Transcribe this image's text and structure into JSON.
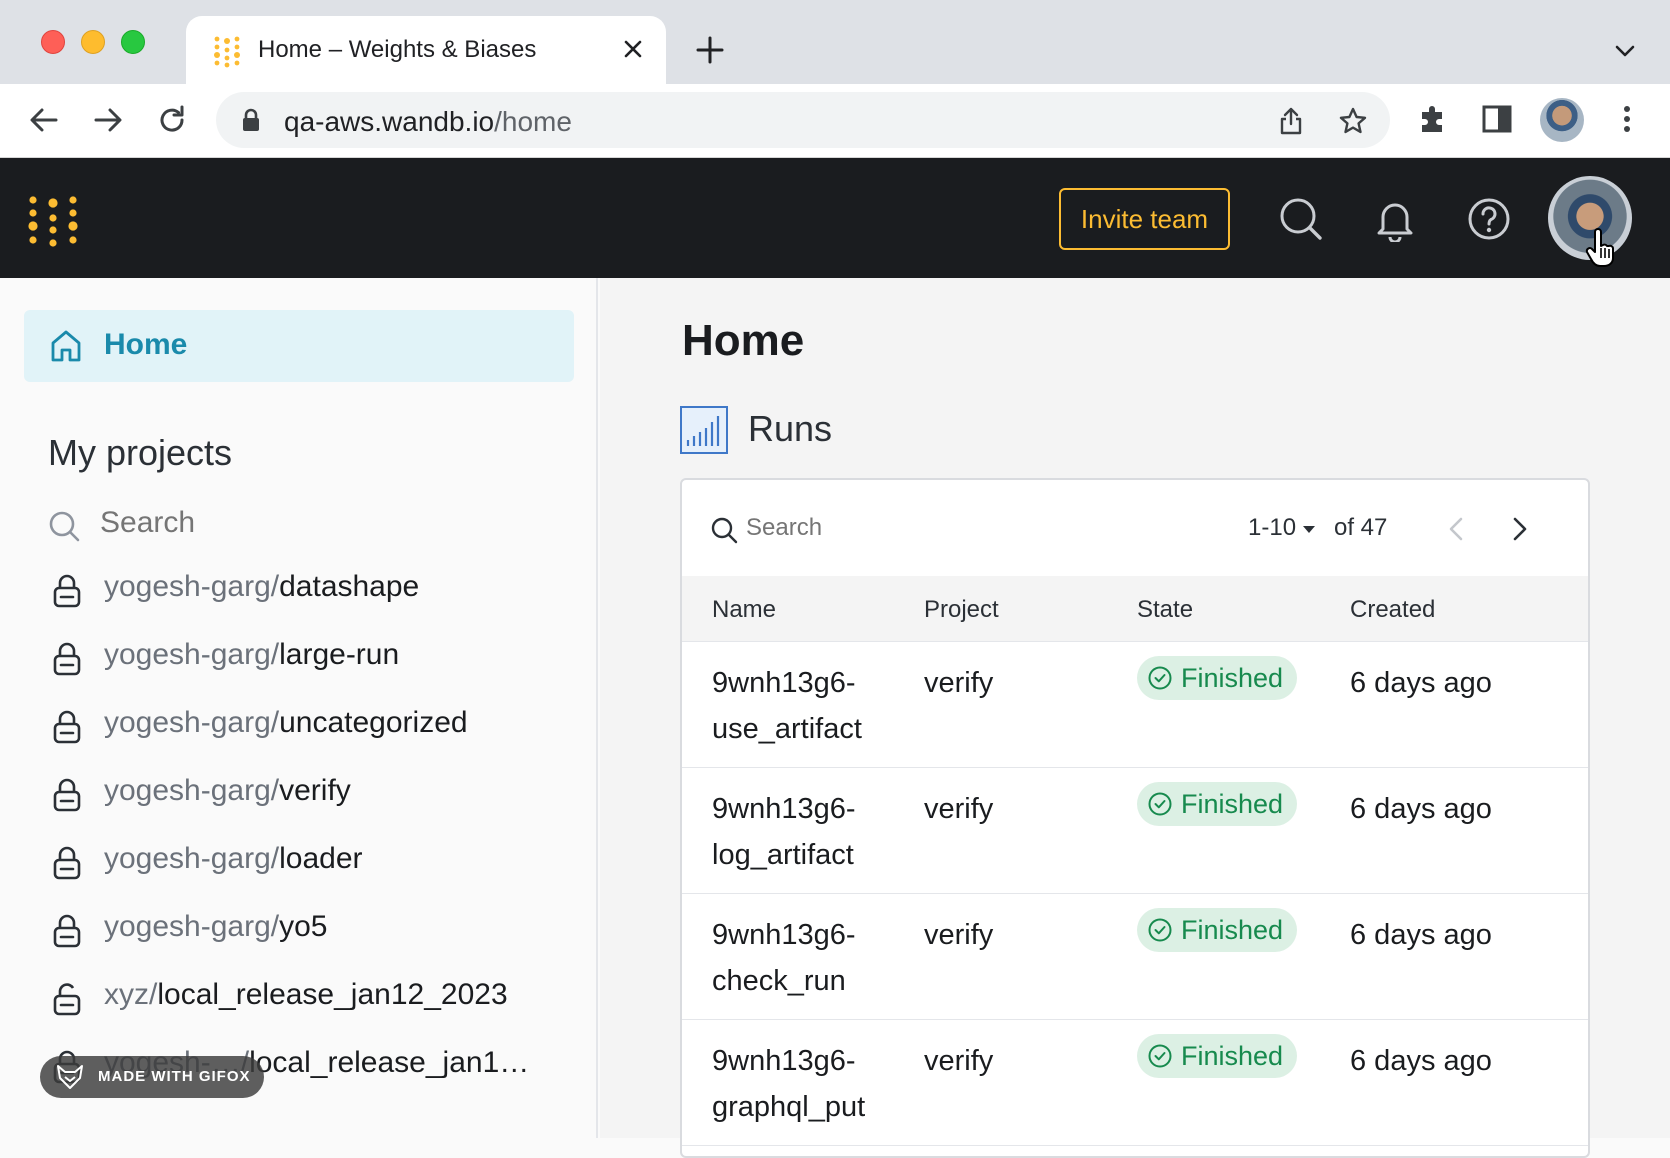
{
  "browser": {
    "tab_title": "Home – Weights & Biases",
    "url_host": "qa-aws.wandb.io",
    "url_path": "/home"
  },
  "appbar": {
    "invite_label": "Invite team"
  },
  "sidebar": {
    "home_label": "Home",
    "projects_heading": "My projects",
    "search_placeholder": "Search",
    "projects": [
      {
        "entity": "yogesh-garg/",
        "name": "datashape"
      },
      {
        "entity": "yogesh-garg/",
        "name": "large-run"
      },
      {
        "entity": "yogesh-garg/",
        "name": "uncategorized"
      },
      {
        "entity": "yogesh-garg/",
        "name": "verify"
      },
      {
        "entity": "yogesh-garg/",
        "name": "loader"
      },
      {
        "entity": "yogesh-garg/",
        "name": "yo5"
      },
      {
        "entity": "xyz/",
        "name": "local_release_jan12_2023"
      },
      {
        "entity": "yogesh-…/",
        "name": "local_release_jan1…"
      }
    ]
  },
  "main": {
    "title": "Home",
    "runs_label": "Runs",
    "search_placeholder": "Search",
    "pager_range": "1-10",
    "pager_total": "of 47",
    "columns": [
      "Name",
      "Project",
      "State",
      "Created"
    ],
    "rows": [
      {
        "name_1": "9wnh13g6-",
        "name_2": "use_artifact",
        "project": "verify",
        "state": "Finished",
        "created": "6 days ago"
      },
      {
        "name_1": "9wnh13g6-",
        "name_2": "log_artifact",
        "project": "verify",
        "state": "Finished",
        "created": "6 days ago"
      },
      {
        "name_1": "9wnh13g6-",
        "name_2": "check_run",
        "project": "verify",
        "state": "Finished",
        "created": "6 days ago"
      },
      {
        "name_1": "9wnh13g6-",
        "name_2": "graphql_put",
        "project": "verify",
        "state": "Finished",
        "created": "6 days ago"
      }
    ]
  },
  "overlay": {
    "gifox_label": "MADE WITH GIFOX"
  },
  "colors": {
    "accent_yellow": "#fcbc32",
    "home_teal": "#1a8aab",
    "finished_green": "#178a4e",
    "appbar_bg": "#1a1c1f"
  }
}
